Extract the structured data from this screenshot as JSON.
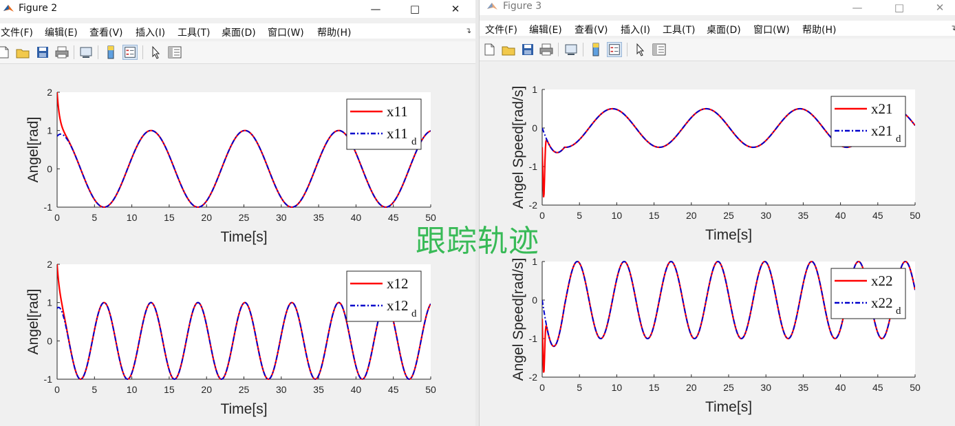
{
  "overlay_text": "跟踪轨迹",
  "menu": [
    "文件(F)",
    "编辑(E)",
    "查看(V)",
    "插入(I)",
    "工具(T)",
    "桌面(D)",
    "窗口(W)",
    "帮助(H)"
  ],
  "toolbar_icons": [
    "new-figure-icon",
    "open-file-icon",
    "save-icon",
    "print-icon",
    "link-plot-icon",
    "colorbar-icon",
    "legend-icon",
    "edit-plot-icon",
    "property-inspector-icon"
  ],
  "colors": {
    "actual": "#ff0000",
    "desired": "#0000cc",
    "overlay": "#2fb84f"
  },
  "windows": {
    "fig2": {
      "title": "Figure 2",
      "controls": [
        "minimize-icon",
        "maximize-icon",
        "close-icon"
      ],
      "plots": [
        {
          "ylabel": "Angel[rad]",
          "xlabel": "Time[s]",
          "legend": [
            {
              "text": "x11",
              "sub": ""
            },
            {
              "text": "x11",
              "sub": "d"
            }
          ],
          "yticks": [
            "-1",
            "0",
            "1",
            "2"
          ]
        },
        {
          "ylabel": "Angel[rad]",
          "xlabel": "Time[s]",
          "legend": [
            {
              "text": "x12",
              "sub": ""
            },
            {
              "text": "x12",
              "sub": "d"
            }
          ],
          "yticks": [
            "-1",
            "0",
            "1",
            "2"
          ]
        }
      ]
    },
    "fig3": {
      "title": "Figure 3",
      "controls": [
        "minimize-icon",
        "maximize-icon",
        "close-icon"
      ],
      "plots": [
        {
          "ylabel": "Angel Speed[rad/s]",
          "xlabel": "Time[s]",
          "legend": [
            {
              "text": "x21",
              "sub": ""
            },
            {
              "text": "x21",
              "sub": "d"
            }
          ],
          "yticks": [
            "-2",
            "-1",
            "0",
            "1"
          ]
        },
        {
          "ylabel": "Angel Speed[rad/s]",
          "xlabel": "Time[s]",
          "legend": [
            {
              "text": "x22",
              "sub": ""
            },
            {
              "text": "x22",
              "sub": "d"
            }
          ],
          "yticks": [
            "-2",
            "-1",
            "0",
            "1"
          ]
        }
      ]
    }
  },
  "xticks": [
    "0",
    "5",
    "10",
    "15",
    "20",
    "25",
    "30",
    "35",
    "40",
    "45",
    "50"
  ],
  "chart_data": [
    {
      "type": "line",
      "xlabel": "Time[s]",
      "ylabel": "Angel[rad]",
      "xlim": [
        0,
        50
      ],
      "ylim": [
        -1,
        2
      ],
      "series": [
        {
          "name": "x11",
          "desc": "cos(0.5 t) with initial transient",
          "amplitude": 1,
          "omega": 0.5,
          "phase": "cos",
          "initial": 2
        },
        {
          "name": "x11_d",
          "amplitude": 1,
          "omega": 0.5,
          "phase": "cos",
          "initial": 1
        }
      ]
    },
    {
      "type": "line",
      "xlabel": "Time[s]",
      "ylabel": "Angel[rad]",
      "xlim": [
        0,
        50
      ],
      "ylim": [
        -1,
        2
      ],
      "series": [
        {
          "name": "x12",
          "amplitude": 1,
          "omega": 1.0,
          "phase": "cos",
          "initial": 2
        },
        {
          "name": "x12_d",
          "amplitude": 1,
          "omega": 1.0,
          "phase": "cos",
          "initial": 1
        }
      ]
    },
    {
      "type": "line",
      "xlabel": "Time[s]",
      "ylabel": "Angel Speed[rad/s]",
      "xlim": [
        0,
        50
      ],
      "ylim": [
        -2,
        1
      ],
      "series": [
        {
          "name": "x21",
          "amplitude": 0.5,
          "omega": 0.5,
          "phase": "-sin",
          "initial": 0,
          "transient_min": -1.8
        },
        {
          "name": "x21_d",
          "amplitude": 0.5,
          "omega": 0.5,
          "phase": "-sin",
          "initial": 0
        }
      ]
    },
    {
      "type": "line",
      "xlabel": "Time[s]",
      "ylabel": "Angel Speed[rad/s]",
      "xlim": [
        0,
        50
      ],
      "ylim": [
        -2,
        1
      ],
      "series": [
        {
          "name": "x22",
          "amplitude": 1,
          "omega": 1.0,
          "phase": "-sin",
          "initial": 0,
          "transient_min": -1.75
        },
        {
          "name": "x22_d",
          "amplitude": 1,
          "omega": 1.0,
          "phase": "-sin",
          "initial": 0
        }
      ]
    }
  ]
}
